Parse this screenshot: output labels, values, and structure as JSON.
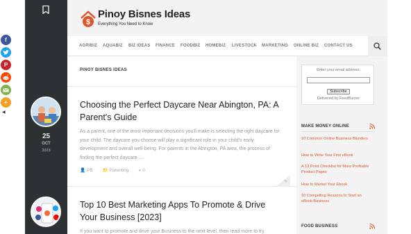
{
  "site": {
    "title": "Pinoy Bisnes Ideas",
    "tagline": "Everything You Need to Know",
    "logo_icon": "house-dollar-icon"
  },
  "nav": {
    "items": [
      "AGRIBIZ",
      "AQUABIZ",
      "BIZ IDEAS",
      "FINANCE",
      "FOODBIZ",
      "HOMEBIZ",
      "LIVESTOCK",
      "MARKETING",
      "ONLINE BIZ",
      "CONTACT US"
    ],
    "search_icon": "search-icon"
  },
  "main": {
    "section_heading": "PINOY BISNES IDEAS",
    "posts": [
      {
        "title": "Choosing the Perfect Daycare Near Abington, PA: A Parent's Guide",
        "excerpt": "As a parent, one of the most important decisions you'll make is selecting the right daycare for your child. The daycare you choose will play a significant role in your child's early development and overall well-being. For parents in the Abington, PA area, the process of finding the perfect daycare …",
        "author": "PB",
        "category": "Parenting",
        "comments": "0",
        "day": "25",
        "month": "OCT",
        "year": "2023"
      },
      {
        "title": "Top 10 Best Marketing Apps To Promote & Drive Your Business [2023]",
        "excerpt": "If you want to promote and drive your Business to the next level, then read more to try"
      }
    ]
  },
  "sidebar": {
    "subscribe": {
      "label": "Enter your email address:",
      "input_value": "",
      "button": "Subscribe",
      "delivered": "Delivered by FeedBurner"
    },
    "widgets": [
      {
        "title": "MAKE MONEY ONLINE",
        "links": [
          "10 Common Online Business Blunders",
          "How to Write Your First eBook",
          "A 13 Point Checklist for More Profitable Product Pages",
          "How to Market Your Ebook",
          "10 Compelling Reasons to Start an eBook Business"
        ]
      },
      {
        "title": "FOOD BUSINESS",
        "links": []
      }
    ]
  },
  "share": [
    "facebook",
    "twitter",
    "pinterest",
    "reddit",
    "email",
    "more"
  ],
  "colors": {
    "accent": "#e0562b",
    "dark_column": "#2e3133",
    "facebook": "#3b5998",
    "twitter": "#1da1f2",
    "pinterest": "#cb2027",
    "reddit": "#ff4500",
    "email": "#7fb04a",
    "more": "#f2a027"
  }
}
